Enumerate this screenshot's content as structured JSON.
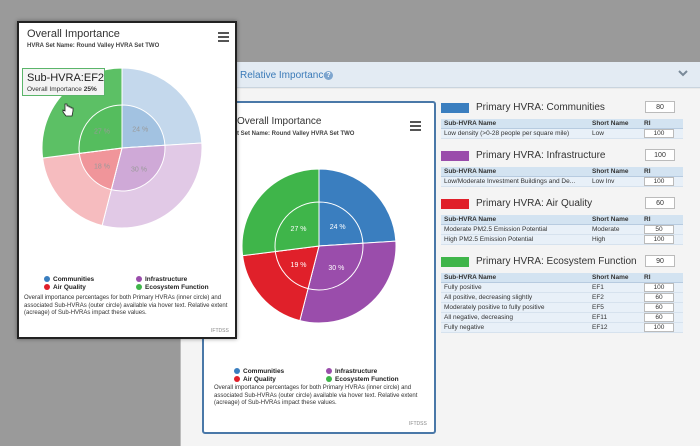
{
  "panel": {
    "title": "Relative Importance",
    "info_icon": "info-icon",
    "collapse_icon": "chevron-down-icon"
  },
  "back_chart": {
    "title": "Overall Importance",
    "subtitle": "t Set Name: Round Valley HVRA Set TWO",
    "watermark": "IFTDSS",
    "caption": "Overall importance percentages for both Primary HVRAs (inner circle) and associated Sub-HVRAs (outer circle) available via hover text. Relative extent (acreage) of Sub-HVRAs impact these values."
  },
  "front_chart": {
    "title": "Overall Importance",
    "subtitle": "HVRA Set Name: Round Valley HVRA Set TWO",
    "watermark": "IFTDSS",
    "caption": "Overall importance percentages for both Primary HVRAs (inner circle) and associated Sub-HVRAs (outer circle) available via hover text. Relative extent (acreage) of Sub-HVRAs impact these values.",
    "tooltip": {
      "title": "Sub-HVRA:EF2",
      "label": "Overall Importance",
      "value": "25%"
    }
  },
  "legend": [
    {
      "label": "Communities",
      "color": "#3a7ebf"
    },
    {
      "label": "Infrastructure",
      "color": "#9a4dab"
    },
    {
      "label": "Air Quality",
      "color": "#e0202a"
    },
    {
      "label": "Ecosystem Function",
      "color": "#3fb54a"
    }
  ],
  "chart_data": {
    "type": "pie",
    "title": "Overall Importance",
    "inner": [
      {
        "name": "Communities",
        "value": 24,
        "label": "24 %",
        "color": "#3a7ebf"
      },
      {
        "name": "Infrastructure",
        "value": 30,
        "label": "30 %",
        "color": "#9a4dab"
      },
      {
        "name": "Air Quality",
        "value": 19,
        "label": "19 %",
        "color": "#e0202a"
      },
      {
        "name": "Ecosystem Function",
        "value": 27,
        "label": "27 %",
        "color": "#3fb54a"
      }
    ],
    "front_inner_labels": [
      "24 %",
      "30 %",
      "18 %",
      "27 %"
    ]
  },
  "tables": {
    "header": {
      "name": "Sub-HVRA Name",
      "short": "Short Name",
      "ri": "RI"
    },
    "groups": [
      {
        "title": "Primary HVRA: Communities",
        "value": "80",
        "color": "#3a7ebf",
        "rows": [
          {
            "name": "Low density (>0-28 people per square mile)",
            "short": "Low",
            "ri": "100"
          }
        ]
      },
      {
        "title": "Primary HVRA: Infrastructure",
        "value": "100",
        "color": "#9a4dab",
        "rows": [
          {
            "name": "Low/Moderate Investment Buildings and De...",
            "short": "Low Inv",
            "ri": "100"
          }
        ]
      },
      {
        "title": "Primary HVRA: Air Quality",
        "value": "60",
        "color": "#e0202a",
        "rows": [
          {
            "name": "Moderate PM2.5 Emission Potential",
            "short": "Moderate",
            "ri": "50"
          },
          {
            "name": "High PM2.5 Emission Potential",
            "short": "High",
            "ri": "100"
          }
        ]
      },
      {
        "title": "Primary HVRA: Ecosystem Function",
        "value": "90",
        "color": "#3fb54a",
        "rows": [
          {
            "name": "Fully positive",
            "short": "EF1",
            "ri": "100"
          },
          {
            "name": "All positive, decreasing slightly",
            "short": "EF2",
            "ri": "60"
          },
          {
            "name": "Moderately positive to fully positive",
            "short": "EF5",
            "ri": "60"
          },
          {
            "name": "All negative, decreasing",
            "short": "EF11",
            "ri": "60"
          },
          {
            "name": "Fully negative",
            "short": "EF12",
            "ri": "100"
          }
        ]
      }
    ]
  }
}
